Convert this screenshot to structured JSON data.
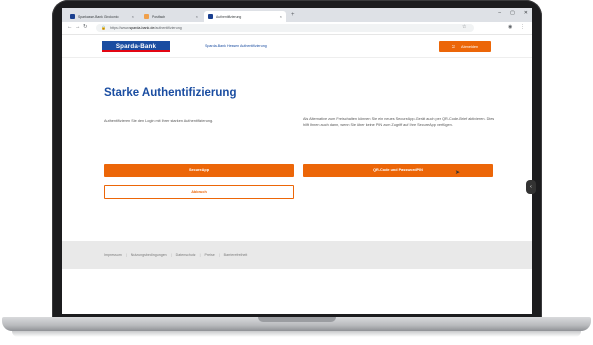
{
  "browser": {
    "tabs": [
      {
        "label": "Sparkasse-Bank Girokonto",
        "active": false
      },
      {
        "label": "Postfach",
        "active": false
      },
      {
        "label": "Authentifizierung",
        "active": true
      }
    ],
    "new_tab": "+",
    "window_controls": [
      "–",
      "▢",
      "✕"
    ],
    "url_prefix": "https://www.",
    "url_domain": "sparda-bank.de",
    "url_suffix": "/authentifizierung",
    "accent": "#1a4da1"
  },
  "page": {
    "logo": "Sparda-Bank",
    "header_link": "Sparda-Bank Hessen Authentifizierung",
    "logout_label": "Abmelden",
    "title": "Starke Authentifizierung",
    "description_left": "Authentifizieren Sie den Login mit Ihrer starken Authentifizierung.",
    "description_right": "Als Alternative zum Freischalten können Sie ein neues SecureApp-Gerät auch per QR-Code-Brief aktivieren. Dies hilft Ihnen auch dann, wenn Sie über keine PIN zum Zugriff auf Ihre SecureApp verfügen.",
    "buttons": {
      "secure_app": "SecureApp",
      "qr_code": "QR-Code und PasswordPIN",
      "abort": "Abbruch"
    },
    "side_handle": "‹",
    "primary_color": "#ec6608"
  },
  "footer": {
    "links": [
      "Impressum",
      "Nutzungsbedingungen",
      "Datenschutz",
      "Preise",
      "Barrierefreiheit"
    ]
  }
}
